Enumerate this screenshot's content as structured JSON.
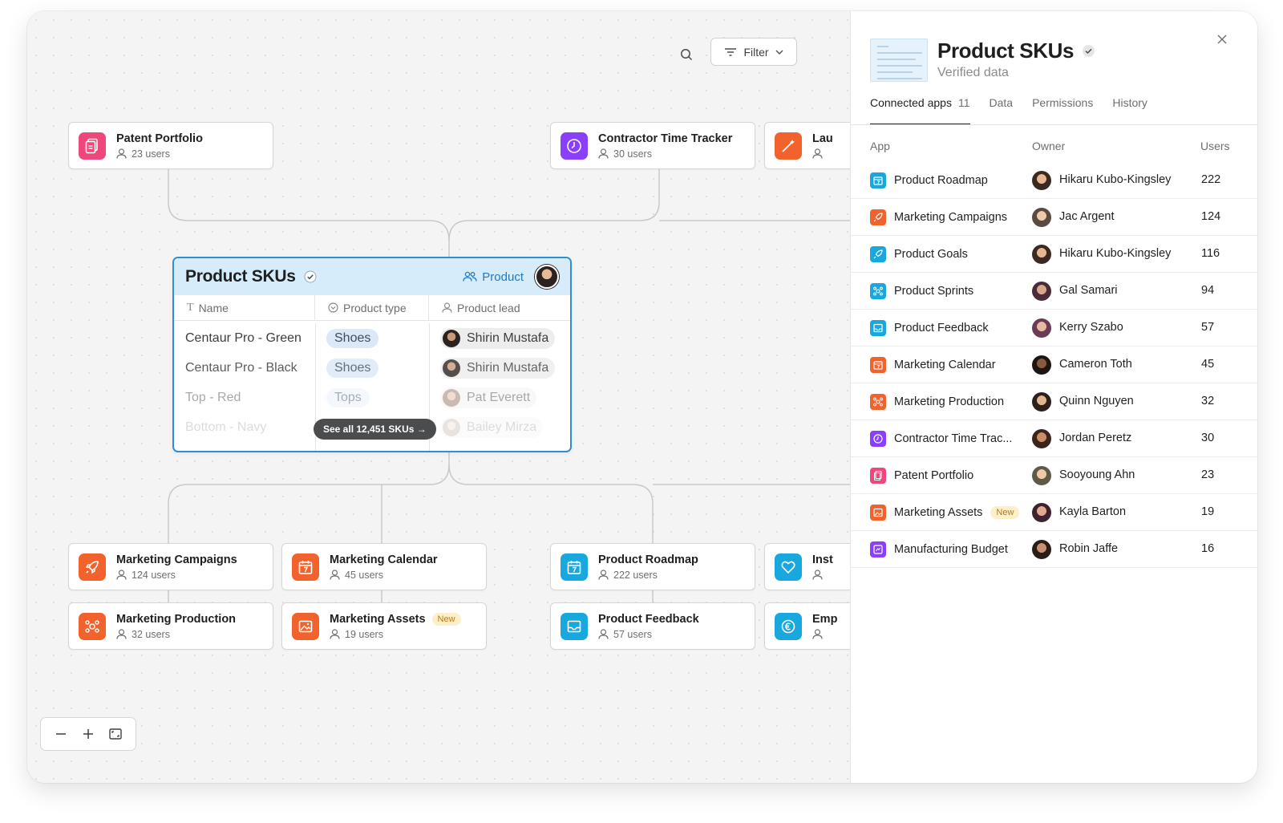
{
  "toolbar": {
    "filter_label": "Filter"
  },
  "colors": {
    "pink": "#f0477a",
    "purple": "#8a3ffc",
    "orange": "#f2622d",
    "blue": "#18a8de",
    "accent": "#2f8fd6"
  },
  "nodes": {
    "patent": {
      "title": "Patent Portfolio",
      "users": "23 users",
      "icon": "document-icon"
    },
    "contractor": {
      "title": "Contractor Time Tracker",
      "users": "30 users",
      "icon": "clock-icon"
    },
    "launch": {
      "title": "Lau",
      "users": "",
      "icon": "wand-icon"
    },
    "mkt_campaigns": {
      "title": "Marketing Campaigns",
      "users": "124 users",
      "icon": "rocket-icon"
    },
    "mkt_calendar": {
      "title": "Marketing Calendar",
      "users": "45 users",
      "icon": "calendar-icon"
    },
    "roadmap": {
      "title": "Product Roadmap",
      "users": "222 users",
      "icon": "calendar-icon"
    },
    "insights": {
      "title": "Inst",
      "users": "",
      "icon": "heart-icon"
    },
    "mkt_production": {
      "title": "Marketing Production",
      "users": "32 users",
      "icon": "nodes-icon"
    },
    "mkt_assets": {
      "title": "Marketing Assets",
      "users": "19 users",
      "badge": "New",
      "icon": "image-icon"
    },
    "feedback": {
      "title": "Product Feedback",
      "users": "57 users",
      "icon": "inbox-icon"
    },
    "employee": {
      "title": "Emp",
      "users": "",
      "icon": "coin-icon"
    }
  },
  "sku_card": {
    "title": "Product SKUs",
    "tag": "Product",
    "columns": [
      "Name",
      "Product type",
      "Product lead"
    ],
    "rows": [
      {
        "name": "Centaur Pro - Green",
        "type": "Shoes",
        "lead": "Shirin Mustafa"
      },
      {
        "name": "Centaur Pro - Black",
        "type": "Shoes",
        "lead": "Shirin Mustafa"
      },
      {
        "name": "Top - Red",
        "type": "Tops",
        "lead": "Pat Everett"
      },
      {
        "name": "Bottom - Navy",
        "type": "",
        "lead": "Bailey Mirza"
      }
    ],
    "see_all": "See all 12,451 SKUs →"
  },
  "panel": {
    "title": "Product SKUs",
    "subtitle": "Verified data",
    "tabs": [
      {
        "label": "Connected apps",
        "count": "11"
      },
      {
        "label": "Data"
      },
      {
        "label": "Permissions"
      },
      {
        "label": "History"
      }
    ],
    "columns": {
      "app": "App",
      "owner": "Owner",
      "users": "Users"
    },
    "rows": [
      {
        "app": "Product Roadmap",
        "owner": "Hikaru Kubo-Kingsley",
        "users": "222",
        "color": "#18a8de"
      },
      {
        "app": "Marketing Campaigns",
        "owner": "Jac Argent",
        "users": "124",
        "color": "#f2622d"
      },
      {
        "app": "Product Goals",
        "owner": "Hikaru Kubo-Kingsley",
        "users": "116",
        "color": "#18a8de"
      },
      {
        "app": "Product Sprints",
        "owner": "Gal Samari",
        "users": "94",
        "color": "#18a8de"
      },
      {
        "app": "Product Feedback",
        "owner": "Kerry Szabo",
        "users": "57",
        "color": "#18a8de"
      },
      {
        "app": "Marketing Calendar",
        "owner": "Cameron Toth",
        "users": "45",
        "color": "#f2622d"
      },
      {
        "app": "Marketing Production",
        "owner": "Quinn Nguyen",
        "users": "32",
        "color": "#f2622d"
      },
      {
        "app": "Contractor Time Trac...",
        "owner": "Jordan Peretz",
        "users": "30",
        "color": "#8a3ffc"
      },
      {
        "app": "Patent Portfolio",
        "owner": "Sooyoung Ahn",
        "users": "23",
        "color": "#f0477a"
      },
      {
        "app": "Marketing Assets",
        "owner": "Kayla Barton",
        "users": "19",
        "color": "#f2622d",
        "badge": "New"
      },
      {
        "app": "Manufacturing Budget",
        "owner": "Robin Jaffe",
        "users": "16",
        "color": "#8a3ffc"
      }
    ]
  }
}
